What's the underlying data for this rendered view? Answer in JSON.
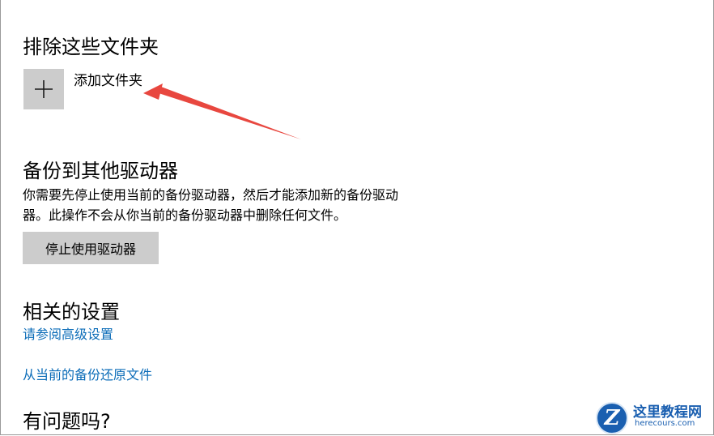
{
  "exclude": {
    "heading": "排除这些文件夹",
    "add_label": "添加文件夹",
    "add_icon": "plus-icon"
  },
  "backup_other": {
    "heading": "备份到其他驱动器",
    "desc_line1": "你需要先停止使用当前的备份驱动器，然后才能添加新的备份驱动",
    "desc_line2": "器。此操作不会从你当前的备份驱动器中删除任何文件。",
    "stop_button": "停止使用驱动器"
  },
  "related": {
    "heading": "相关的设置",
    "link_advanced": "请参阅高级设置",
    "link_restore": "从当前的备份还原文件"
  },
  "help": {
    "heading": "有问题吗?"
  },
  "watermark": {
    "logo_letter": "Z",
    "title": "这里教程网",
    "url": "herecours.com"
  },
  "colors": {
    "link": "#0b6cb8",
    "tile": "#cccccc",
    "annotation_arrow": "#e8473f"
  }
}
